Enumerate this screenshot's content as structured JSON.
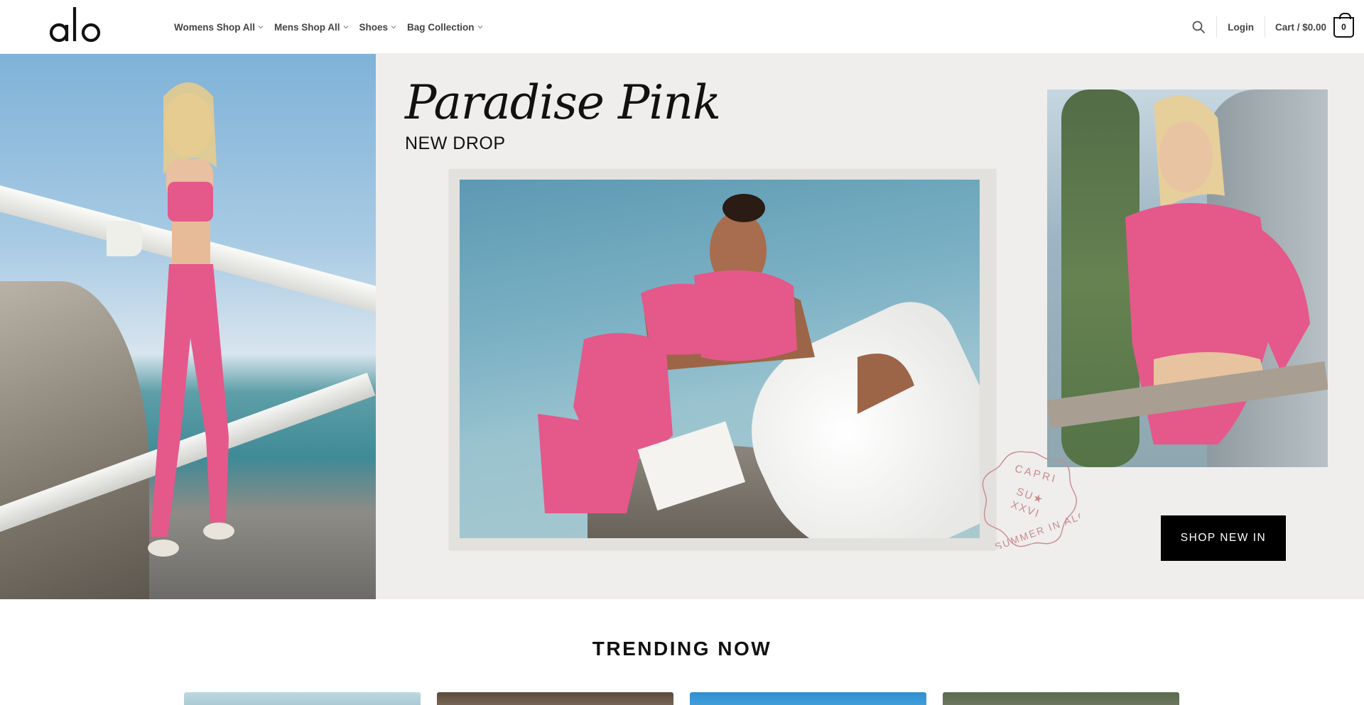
{
  "header": {
    "logo_text": "alo",
    "nav": [
      {
        "label": "Womens Shop All"
      },
      {
        "label": "Mens Shop All"
      },
      {
        "label": "Shoes"
      },
      {
        "label": "Bag Collection"
      }
    ],
    "login_label": "Login",
    "cart_label": "Cart / $0.00",
    "cart_count": "0"
  },
  "hero": {
    "title": "Paradise Pink",
    "subtitle": "NEW DROP",
    "cta_label": "SHOP NEW IN",
    "stamp_text": "CAPRI SU★ XXVI SUMMER IN ALO",
    "colors": {
      "pink": "#e5588a",
      "background": "#efeeec"
    }
  },
  "trending": {
    "heading": "TRENDING NOW"
  }
}
